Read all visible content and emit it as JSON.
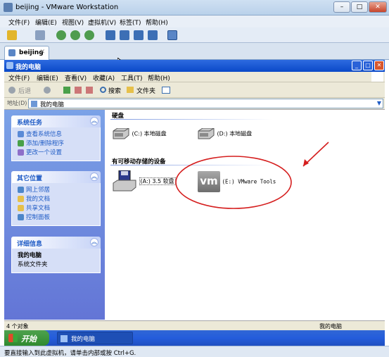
{
  "host": {
    "title": "beijing - VMware Workstation",
    "menu": [
      "文件(F)",
      "编辑(E)",
      "视图(V)",
      "虚拟机(V)",
      "标签(T)",
      "帮助(H)"
    ],
    "tab": "beijing",
    "status": "要直接输入到此虚拟机，请单击内部或按 Ctrl+G."
  },
  "guest": {
    "title": "我的电脑",
    "menu": [
      "文件(F)",
      "编辑(E)",
      "查看(V)",
      "收藏(A)",
      "工具(T)",
      "帮助(H)"
    ],
    "toolbar": {
      "back": "后退",
      "search": "搜索",
      "folders": "文件夹"
    },
    "address_label": "地址(D)",
    "address_value": "我的电脑",
    "panels": {
      "tasks": {
        "title": "系统任务",
        "items": [
          "查看系统信息",
          "添加/删除程序",
          "更改一个设置"
        ]
      },
      "places": {
        "title": "其它位置",
        "items": [
          "网上邻居",
          "我的文档",
          "共享文档",
          "控制面板"
        ]
      },
      "details": {
        "title": "详细信息",
        "name": "我的电脑",
        "type": "系统文件夹"
      }
    },
    "sections": {
      "hard": "硬盘",
      "removable": "有可移动存储的设备"
    },
    "drives": {
      "c": "(C:) 本地磁盘",
      "d": "(D:) 本地磁盘",
      "a": "(A:) 3.5 软盘",
      "e": "(E:) VMware Tools",
      "vm_logo": "vm"
    },
    "status_left": "4 个对象",
    "status_right": "我的电脑",
    "start": "开始",
    "task_button": "我的电脑"
  },
  "colors": {
    "annotation": "#d51e1e",
    "xp_blue": "#0a49c8"
  }
}
